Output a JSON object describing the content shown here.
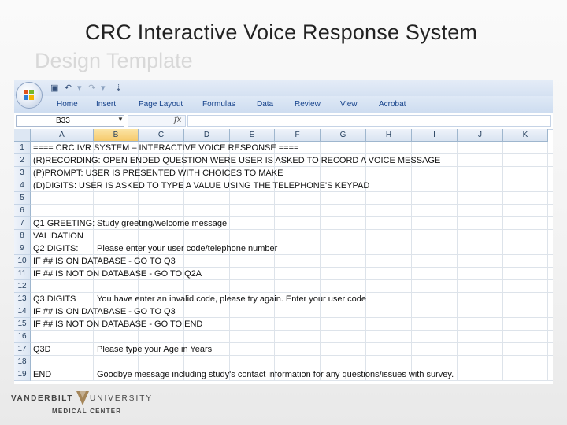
{
  "slide": {
    "title": "CRC Interactive Voice Response System",
    "subtitle": "Design Template"
  },
  "excel": {
    "tabs": [
      "Home",
      "Insert",
      "Page Layout",
      "Formulas",
      "Data",
      "Review",
      "View",
      "Acrobat"
    ],
    "name_box": "B33",
    "fx_label": "fx",
    "columns": [
      "A",
      "B",
      "C",
      "D",
      "E",
      "F",
      "G",
      "H",
      "I",
      "J",
      "K"
    ],
    "selected_column": "B",
    "rows": [
      {
        "num": "1",
        "a": "==== CRC IVR SYSTEM – INTERACTIVE VOICE RESPONSE ====",
        "b": ""
      },
      {
        "num": "2",
        "a": "(R)RECORDING: OPEN ENDED QUESTION WERE USER IS ASKED TO RECORD A VOICE MESSAGE",
        "b": ""
      },
      {
        "num": "3",
        "a": "(P)PROMPT: USER IS PRESENTED WITH CHOICES TO MAKE",
        "b": ""
      },
      {
        "num": "4",
        "a": "(D)DIGITS: USER IS ASKED TO TYPE A VALUE USING THE TELEPHONE'S KEYPAD",
        "b": ""
      },
      {
        "num": "5",
        "a": "",
        "b": ""
      },
      {
        "num": "6",
        "a": "",
        "b": ""
      },
      {
        "num": "7",
        "a": "Q1 GREETING:",
        "b": "Study greeting/welcome message"
      },
      {
        "num": "8",
        "a": "VALIDATION",
        "b": ""
      },
      {
        "num": "9",
        "a": "Q2 DIGITS:",
        "b": "Please enter your user code/telephone number"
      },
      {
        "num": "10",
        "a": "IF ## IS ON DATABASE - GO TO Q3",
        "b": ""
      },
      {
        "num": "11",
        "a": "IF ## IS NOT ON DATABASE - GO TO Q2A",
        "b": ""
      },
      {
        "num": "12",
        "a": "",
        "b": ""
      },
      {
        "num": "13",
        "a": "Q3 DIGITS",
        "b": "You have enter an invalid code, please try again. Enter your user code"
      },
      {
        "num": "14",
        "a": "IF ## IS ON DATABASE - GO TO Q3",
        "b": ""
      },
      {
        "num": "15",
        "a": "IF ## IS NOT ON DATABASE - GO TO END",
        "b": ""
      },
      {
        "num": "16",
        "a": "",
        "b": ""
      },
      {
        "num": "17",
        "a": "Q3D",
        "b": "Please type your Age in Years"
      },
      {
        "num": "18",
        "a": "",
        "b": ""
      },
      {
        "num": "19",
        "a": "END",
        "b": "Goodbye message including study's contact information for any questions/issues with survey."
      }
    ]
  },
  "footer": {
    "left_word": "VANDERBILT",
    "right_word": "UNIVERSITY",
    "sub": "MEDICAL CENTER"
  }
}
